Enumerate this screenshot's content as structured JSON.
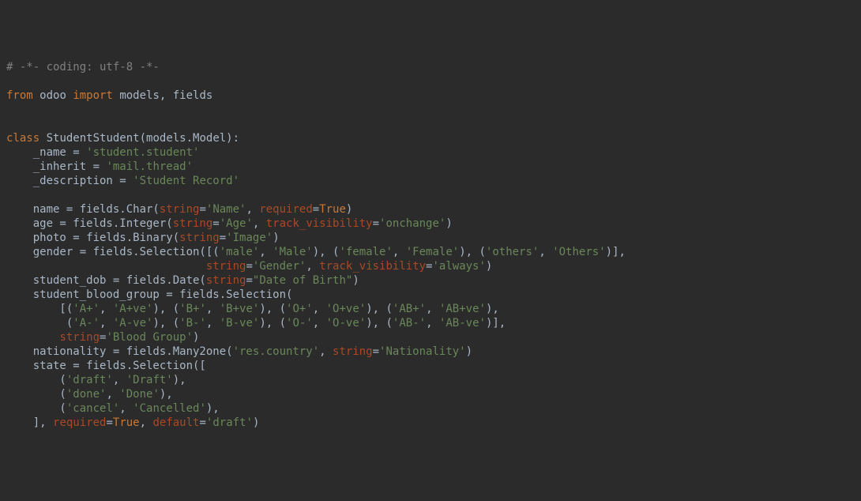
{
  "lines": {
    "l0": "# -*- coding: utf-8 -*-",
    "l1_from": "from",
    "l1_odoo": "odoo",
    "l1_import": "import",
    "l1_rest": "models, fields",
    "l3_class": "class",
    "l3_name": "StudentStudent",
    "l3_rest": "(models.Model):",
    "l4_a": "    _name = ",
    "l4_s": "'student.student'",
    "l5_a": "    _inherit = ",
    "l5_s": "'mail.thread'",
    "l6_a": "    _description = ",
    "l6_s": "'Student Record'",
    "l8_a": "    name = fields.Char(",
    "l8_p1": "string",
    "l8_e": "=",
    "l8_s1": "'Name'",
    "l8_c": ", ",
    "l8_p2": "required",
    "l8_v2": "True",
    "l8_z": ")",
    "l9_a": "    age = fields.Integer(",
    "l9_p1": "string",
    "l9_s1": "'Age'",
    "l9_p2": "track_visibility",
    "l9_s2": "'onchange'",
    "l10_a": "    photo = fields.Binary(",
    "l10_p1": "string",
    "l10_s1": "'Image'",
    "l11_a": "    gender = fields.Selection([(",
    "l11_s1": "'male'",
    "l11_s2": "'Male'",
    "l11_s3": "'female'",
    "l11_s4": "'Female'",
    "l11_s5": "'others'",
    "l11_s6": "'Others'",
    "l12_pad": "                              ",
    "l12_p1": "string",
    "l12_s1": "'Gender'",
    "l12_p2": "track_visibility",
    "l12_s2": "'always'",
    "l13_a": "    student_dob = fields.Date(",
    "l13_p1": "string",
    "l13_s1": "\"Date of Birth\"",
    "l14_a": "    student_blood_group = fields.Selection(",
    "l15_pad": "        [(",
    "l15_s1": "'A+'",
    "l15_s2": "'A+ve'",
    "l15_s3": "'B+'",
    "l15_s4": "'B+ve'",
    "l15_s5": "'O+'",
    "l15_s6": "'O+ve'",
    "l15_s7": "'AB+'",
    "l15_s8": "'AB+ve'",
    "l16_pad": "         (",
    "l16_s1": "'A-'",
    "l16_s2": "'A-ve'",
    "l16_s3": "'B-'",
    "l16_s4": "'B-ve'",
    "l16_s5": "'O-'",
    "l16_s6": "'O-ve'",
    "l16_s7": "'AB-'",
    "l16_s8": "'AB-ve'",
    "l17_pad": "        ",
    "l17_p1": "string",
    "l17_s1": "'Blood Group'",
    "l18_a": "    nationality = fields.Many2one(",
    "l18_s1": "'res.country'",
    "l18_p1": "string",
    "l18_s2": "'Nationality'",
    "l19_a": "    state = fields.Selection([",
    "l20_pad": "        (",
    "l20_s1": "'draft'",
    "l20_s2": "'Draft'",
    "l21_pad": "        (",
    "l21_s1": "'done'",
    "l21_s2": "'Done'",
    "l22_pad": "        (",
    "l22_s1": "'cancel'",
    "l22_s2": "'Cancelled'",
    "l23_a": "    ], ",
    "l23_p1": "required",
    "l23_v1": "True",
    "l23_p2": "default",
    "l23_s2": "'draft'"
  }
}
